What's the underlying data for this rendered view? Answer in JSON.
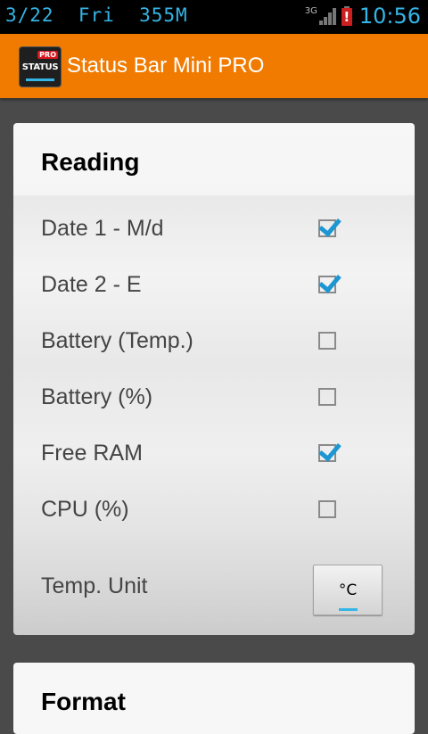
{
  "status_bar": {
    "left_text": "3/22  Fri  355M",
    "network": "3G",
    "time": "10:56"
  },
  "action_bar": {
    "icon_badge": "PRO",
    "icon_label": "STATUS",
    "title": "Status Bar Mini PRO"
  },
  "reading": {
    "title": "Reading",
    "items": [
      {
        "label": "Date 1 - M/d",
        "checked": true
      },
      {
        "label": "Date 2 - E",
        "checked": true
      },
      {
        "label": "Battery (Temp.)",
        "checked": false
      },
      {
        "label": "Battery (%)",
        "checked": false
      },
      {
        "label": "Free RAM",
        "checked": true
      },
      {
        "label": "CPU (%)",
        "checked": false
      }
    ],
    "temp_unit": {
      "label": "Temp. Unit",
      "value": "°C"
    }
  },
  "format": {
    "title": "Format"
  },
  "colors": {
    "accent": "#34b5e5",
    "action_bar": "#f07b00",
    "check": "#1d97d3"
  }
}
